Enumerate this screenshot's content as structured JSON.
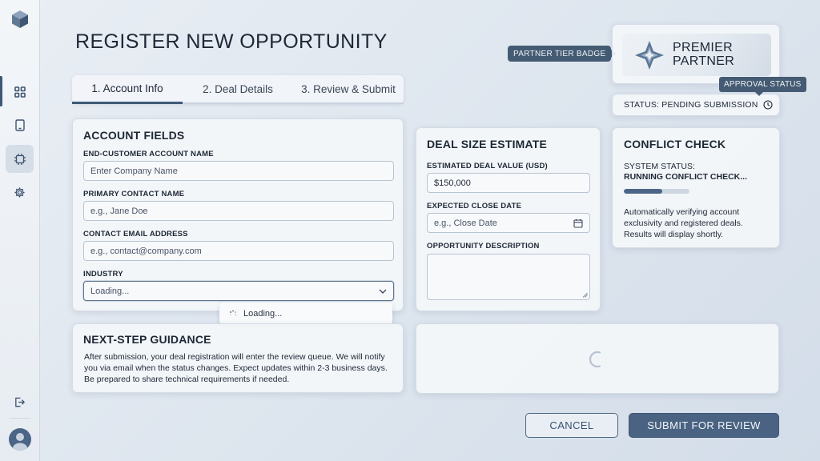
{
  "sidebar": {
    "logo": "cube-logo",
    "items": [
      {
        "name": "dashboard",
        "icon": "grid-icon",
        "active": true
      },
      {
        "name": "documents",
        "icon": "tablet-icon",
        "active": false
      },
      {
        "name": "deals",
        "icon": "chip-icon",
        "active": false
      },
      {
        "name": "settings",
        "icon": "gear-icon",
        "active": false
      }
    ],
    "logout_icon": "logout-icon",
    "avatar_icon": "user-avatar"
  },
  "page": {
    "title": "REGISTER NEW OPPORTUNITY"
  },
  "tabs": [
    {
      "label": "1. Account Info",
      "active": true
    },
    {
      "label": "2. Deal Details",
      "active": false
    },
    {
      "label": "3. Review & Submit",
      "active": false
    }
  ],
  "account": {
    "title": "ACCOUNT FIELDS",
    "company_label": "END-CUSTOMER ACCOUNT NAME",
    "company_placeholder": "Enter Company Name",
    "contact_label": "PRIMARY CONTACT NAME",
    "contact_placeholder": "e.g., Jane Doe",
    "email_label": "CONTACT EMAIL ADDRESS",
    "email_placeholder": "e.g., contact@company.com",
    "industry_label": "INDUSTRY",
    "industry_value": "Loading...",
    "dropdown_loading": "Loading..."
  },
  "guidance": {
    "title": "NEXT-STEP GUIDANCE",
    "text": "After submission, your deal registration will enter the review queue. We will notify you via email when the status changes. Expect updates within 2-3 business days. Be prepared to share technical requirements if needed."
  },
  "deal": {
    "title": "DEAL SIZE ESTIMATE",
    "value_label": "ESTIMATED DEAL VALUE (USD)",
    "value": "$150,000",
    "date_label": "EXPECTED CLOSE DATE",
    "date_placeholder": "e.g., Close Date",
    "desc_label": "OPPORTUNITY DESCRIPTION"
  },
  "badge": {
    "tooltip": "PARTNER TIER BADGE",
    "line1": "PREMIER",
    "line2": "PARTNER"
  },
  "approval": {
    "tooltip": "APPROVAL STATUS",
    "status": "STATUS: PENDING SUBMISSION"
  },
  "conflict": {
    "title": "CONFLICT CHECK",
    "system_label": "SYSTEM STATUS:",
    "system_status": "RUNNING CONFLICT CHECK...",
    "progress": 0.58,
    "description": "Automatically verifying account exclusivity and registered deals. Results will display shortly."
  },
  "actions": {
    "cancel": "CANCEL",
    "submit": "SUBMIT FOR REVIEW"
  },
  "colors": {
    "accent": "#3e5a78",
    "tooltip_bg": "#445b73",
    "submit_bg": "#4a6382"
  }
}
